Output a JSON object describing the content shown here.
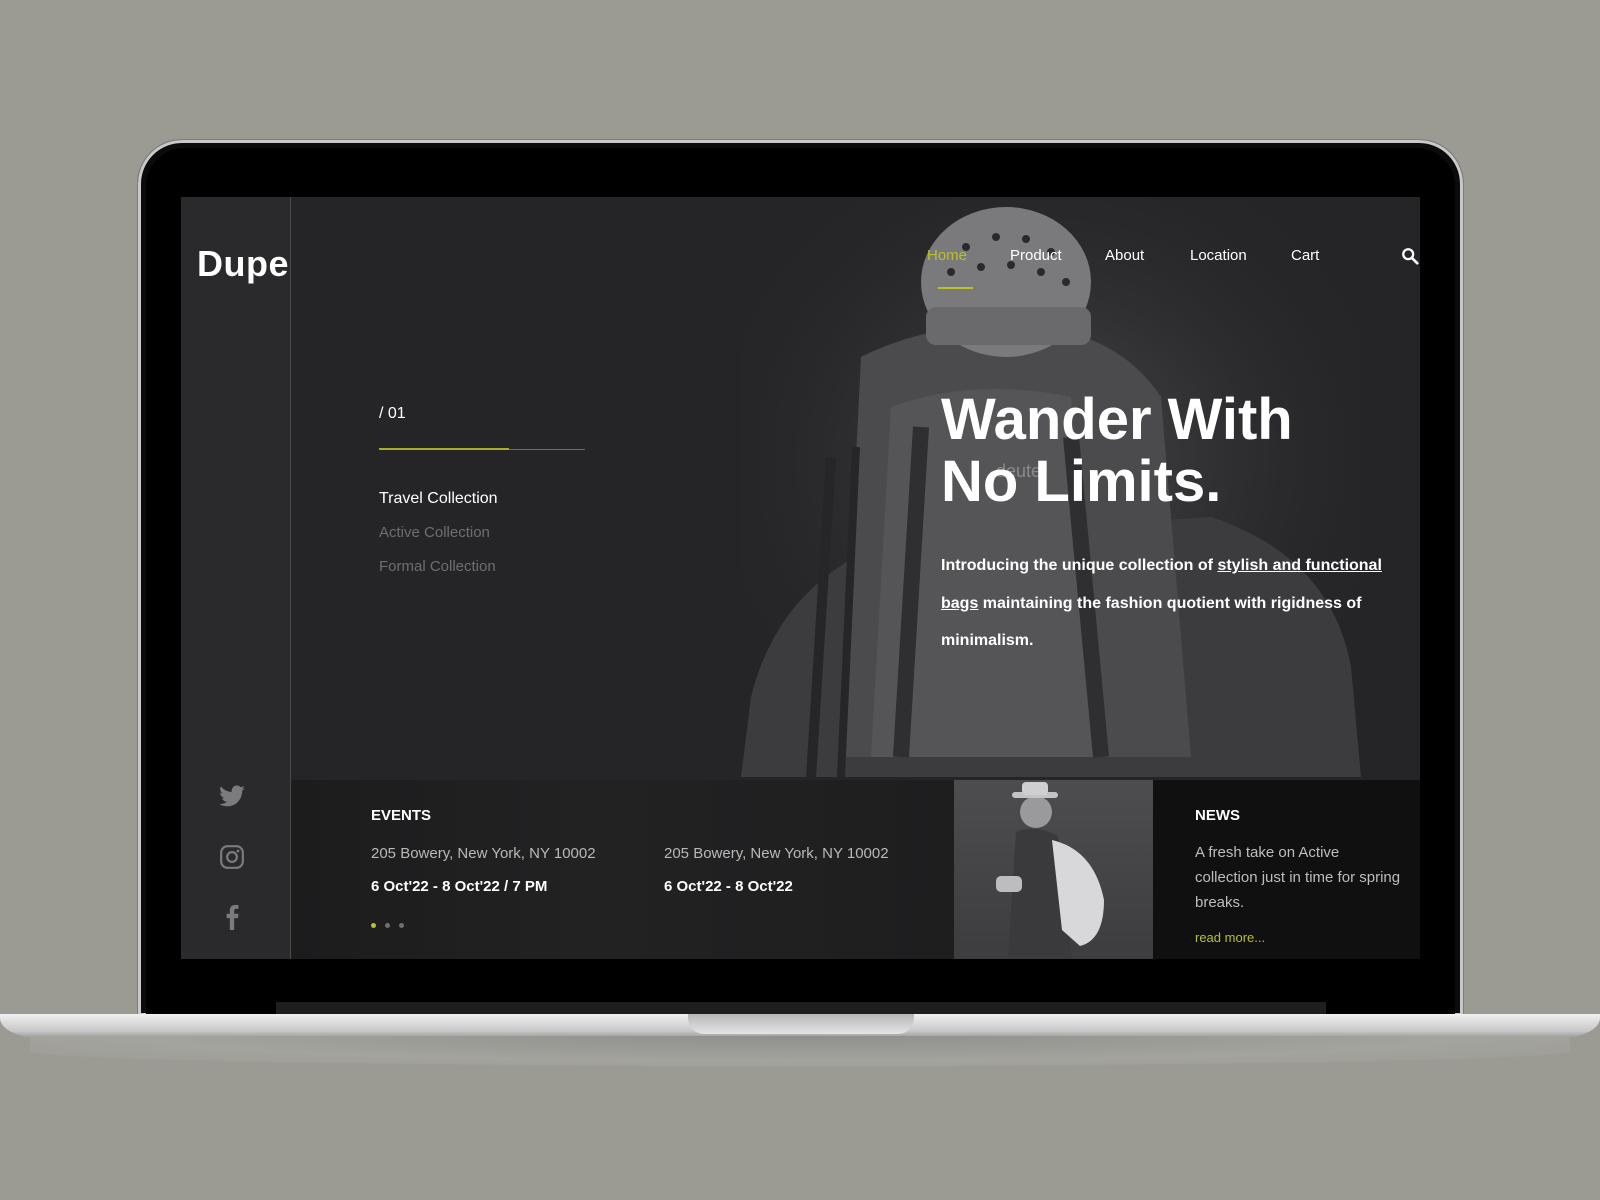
{
  "brand": {
    "logo": "Dupe"
  },
  "nav": {
    "items": [
      "Home",
      "Product",
      "About",
      "Location",
      "Cart"
    ],
    "active": "Home"
  },
  "hero": {
    "slide_number": "/ 01",
    "progress_fraction": 0.63,
    "collections": [
      "Travel Collection",
      "Active Collection",
      "Formal Collection"
    ],
    "headline_line1": "Wander With",
    "headline_line2": "No Limits.",
    "intro_part1": "Introducing the unique collection of ",
    "intro_link": "stylish and functional bags",
    "intro_part2": " maintaining the fashion quotient with rigidness of minimalism.",
    "backpack_brand": "deuter"
  },
  "events": {
    "title": "EVENTS",
    "items": [
      {
        "address": "205 Bowery, New York, NY 10002",
        "date": "6 Oct'22 - 8 Oct'22 / 7 PM"
      },
      {
        "address": "205 Bowery, New York, NY 10002",
        "date": "6 Oct'22 - 8 Oct'22"
      }
    ],
    "pagination": {
      "count": 3,
      "active": 1
    }
  },
  "news": {
    "title": "NEWS",
    "text": "A fresh take on Active collection just in time for spring breaks.",
    "link": "read more..."
  },
  "social_icons": [
    "twitter-icon",
    "instagram-icon",
    "facebook-icon"
  ],
  "colors": {
    "accent": "#b9c126",
    "background": "#252527",
    "outer": "#9b9b93"
  }
}
